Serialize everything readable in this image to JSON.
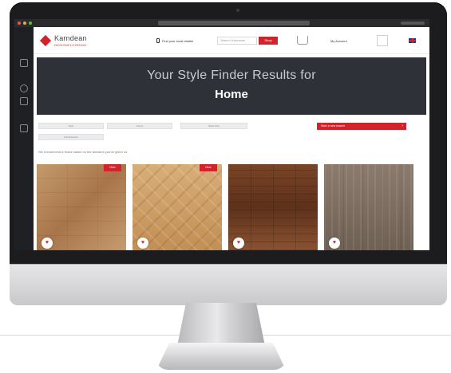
{
  "brand": {
    "name": "Karndean",
    "sub": "DESIGNFLOORING",
    "accent": "#d2232a"
  },
  "header": {
    "contact_label": "Find your local retailer",
    "search_placeholder": "Search Karndean",
    "search_button": "Shop",
    "account_label": "My Account"
  },
  "hero": {
    "line1": "Your Style Finder Results for",
    "line2": "Home"
  },
  "filters": {
    "items": [
      "Style",
      "Colour",
      "Plank Size",
      "Finish/texture"
    ],
    "cta_label": "Start a new search",
    "cta_chevron": "›"
  },
  "results": {
    "recommendation": "We recommend 8 floors based on the answers you've given us",
    "cards": [
      {
        "badge": "New",
        "favorite_glyph": "♥"
      },
      {
        "badge": "New",
        "favorite_glyph": "♥"
      },
      {
        "badge": "",
        "favorite_glyph": "♥"
      },
      {
        "badge": "",
        "favorite_glyph": "♥"
      }
    ]
  }
}
